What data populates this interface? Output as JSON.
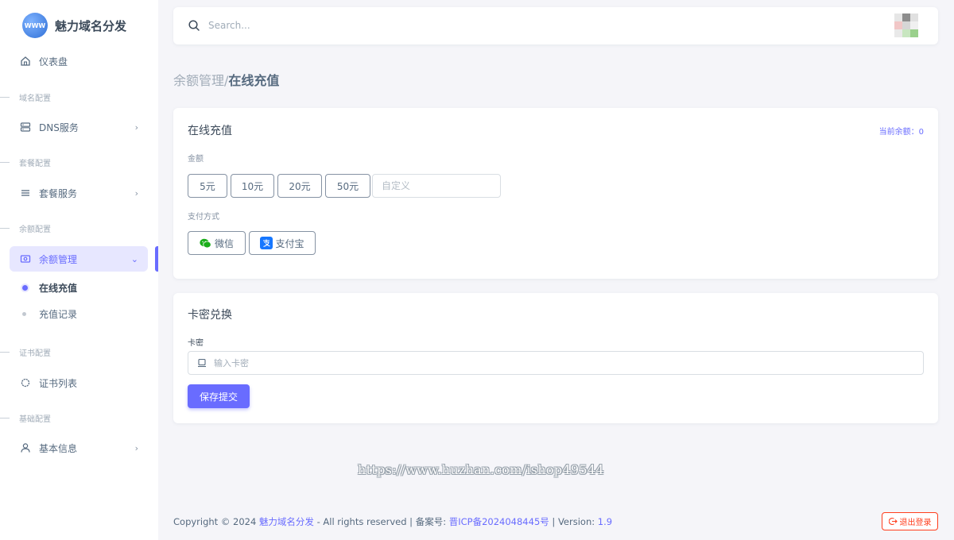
{
  "brand": {
    "name": "魅力域名分发",
    "logo_text": "WWW"
  },
  "sidebar": {
    "dashboard": "仪表盘",
    "sections": {
      "domain": "域名配置",
      "package": "套餐配置",
      "balance": "余额配置",
      "cert": "证书配置",
      "basic": "基础配置"
    },
    "items": {
      "dns": "DNS服务",
      "package": "套餐服务",
      "balance": "余额管理",
      "recharge_online": "在线充值",
      "recharge_records": "充值记录",
      "cert_list": "证书列表",
      "basic_info": "基本信息"
    }
  },
  "topbar": {
    "search_placeholder": "Search..."
  },
  "breadcrumb": {
    "parent": "余额管理/",
    "current": "在线充值"
  },
  "recharge": {
    "title": "在线充值",
    "balance_label": "当前余额：0",
    "amount_label": "金额",
    "amounts": [
      "5元",
      "10元",
      "20元",
      "50元"
    ],
    "custom_placeholder": "自定义",
    "payment_label": "支付方式",
    "payments": {
      "wechat": "微信",
      "alipay": "支付宝"
    }
  },
  "card_redeem": {
    "title": "卡密兑换",
    "field_label": "卡密",
    "placeholder": "输入卡密",
    "submit": "保存提交"
  },
  "watermark": "https://www.huzhan.com/ishop49544",
  "footer": {
    "copyright": "Copyright © 2024 ",
    "site": "魅力域名分发",
    "rights": " - All rights reserved | 备案号: ",
    "icp": "晋ICP备2024048445号",
    "version_label": " | Version: ",
    "version": "1.9"
  },
  "logout": "退出登录",
  "colors": {
    "primary": "#696cff",
    "danger": "#ff3e1d",
    "background": "#f5f5f9"
  }
}
